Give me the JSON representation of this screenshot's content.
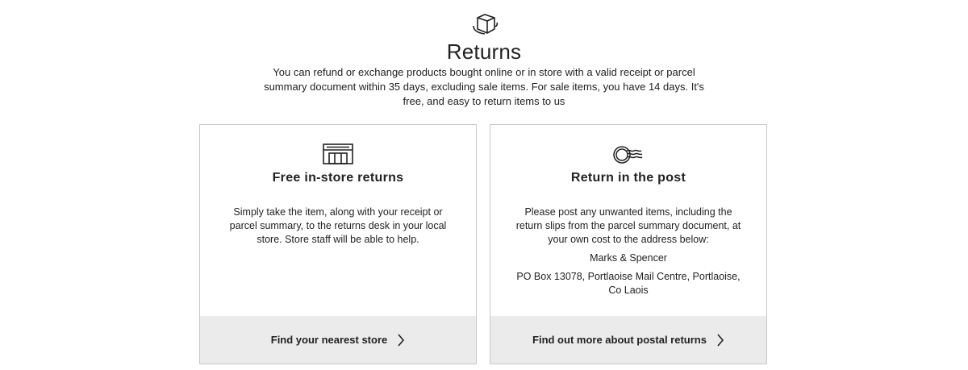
{
  "hero": {
    "icon": "box-icon",
    "title": "Returns",
    "intro": "You can refund or exchange products bought online or in store with a valid receipt or parcel summary document within 35 days, excluding sale items. For sale items, you have 14 days. It's free, and easy to return items to us"
  },
  "cards": [
    {
      "icon": "store-icon",
      "title": "Free in-store returns",
      "body": "Simply take the item, along with your receipt or parcel summary, to the returns desk in your local store. Store staff will be able to help.",
      "link": "Find your nearest store"
    },
    {
      "icon": "postmark-icon",
      "title": "Return in the post",
      "body": "Please post any unwanted items, including the return slips from the parcel summary document, at your own cost to the address below:",
      "address_name": "Marks & Spencer",
      "address_line": "PO Box 13078, Portlaoise Mail Centre, Portlaoise, Co Laois",
      "link": "Find out more about postal returns"
    }
  ]
}
